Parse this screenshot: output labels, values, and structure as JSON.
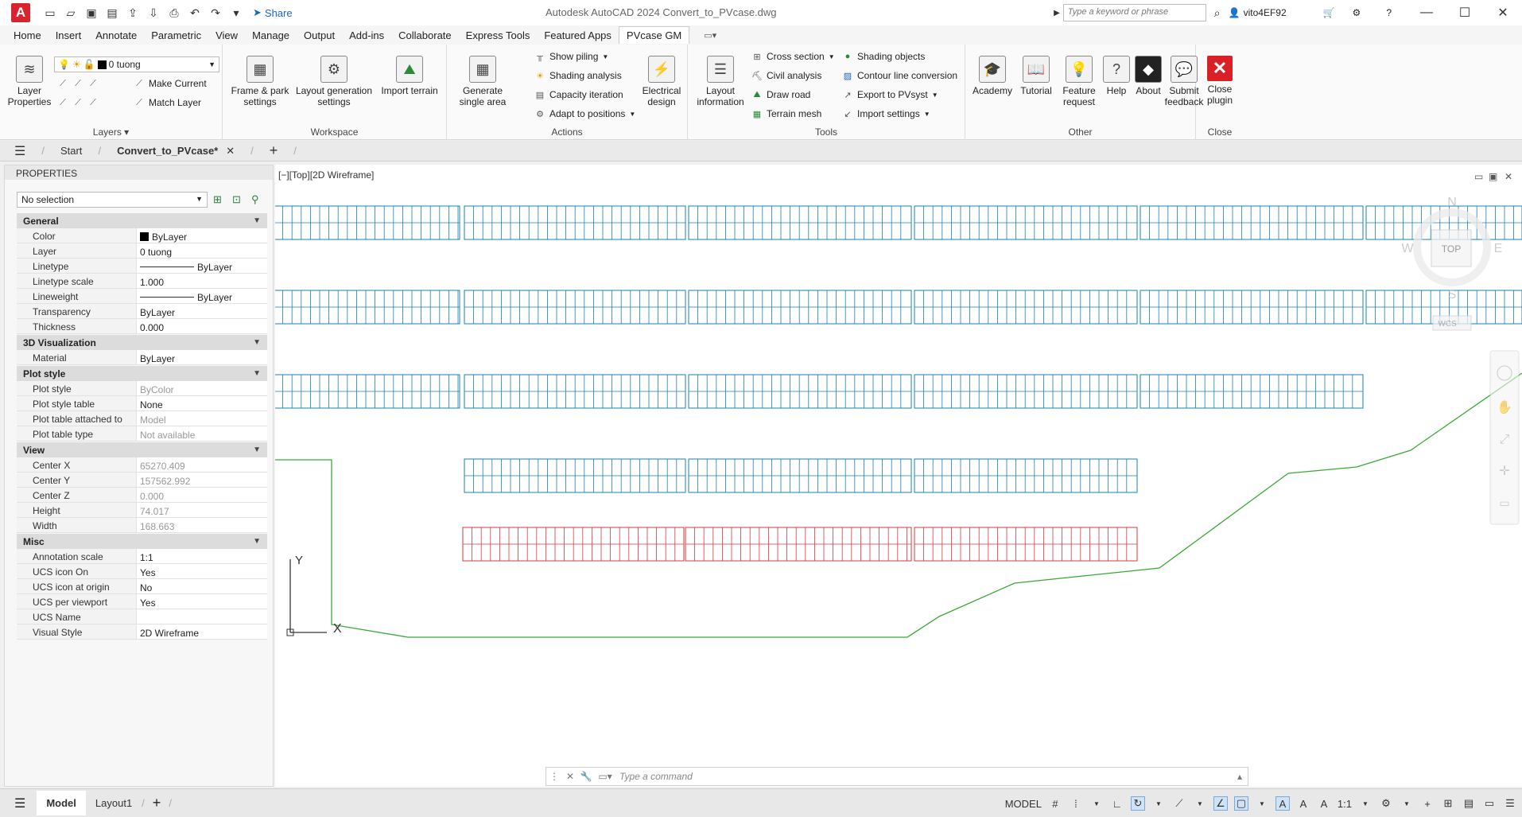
{
  "titlebar": {
    "logo": "A",
    "share": "Share",
    "title": "Autodesk AutoCAD 2024    Convert_to_PVcase.dwg",
    "search_placeholder": "Type a keyword or phrase",
    "user": "vito4EF92"
  },
  "menu": {
    "tabs": [
      "Home",
      "Insert",
      "Annotate",
      "Parametric",
      "View",
      "Manage",
      "Output",
      "Add-ins",
      "Collaborate",
      "Express Tools",
      "Featured Apps",
      "PVcase GM"
    ]
  },
  "ribbon": {
    "layers": {
      "layer_properties": "Layer Properties",
      "current_layer": "0 tuong",
      "make_current": "Make Current",
      "match_layer": "Match Layer",
      "title": "Layers"
    },
    "workspace": {
      "frame_park": "Frame & park settings",
      "layout_generation": "Layout generation settings",
      "import_terrain": "Import terrain",
      "title": "Workspace"
    },
    "actions": {
      "generate_single": "Generate single area",
      "show_piling": "Show piling",
      "shading_analysis": "Shading analysis",
      "capacity_iteration": "Capacity iteration",
      "adapt_positions": "Adapt to positions",
      "electrical_design": "Electrical design",
      "title": "Actions"
    },
    "tools": {
      "layout_information": "Layout information",
      "cross_section": "Cross section",
      "civil_analysis": "Civil analysis",
      "draw_road": "Draw road",
      "terrain_mesh": "Terrain mesh",
      "shading_objects": "Shading objects",
      "contour_conversion": "Contour line conversion",
      "export_pvsyst": "Export to PVsyst",
      "import_settings": "Import settings",
      "title": "Tools"
    },
    "other": {
      "academy": "Academy",
      "tutorial": "Tutorial",
      "feature_request": "Feature request",
      "help": "Help",
      "about": "About",
      "submit_feedback": "Submit feedback",
      "title": "Other"
    },
    "close": {
      "close_plugin": "Close plugin",
      "title": "Close"
    }
  },
  "filetabs": {
    "start": "Start",
    "active": "Convert_to_PVcase*"
  },
  "properties": {
    "header": "PROPERTIES",
    "selection": "No selection",
    "categories": [
      {
        "name": "General",
        "rows": [
          {
            "label": "Color",
            "value": "ByLayer"
          },
          {
            "label": "Layer",
            "value": "0 tuong"
          },
          {
            "label": "Linetype",
            "value": "ByLayer"
          },
          {
            "label": "Linetype scale",
            "value": "1.000"
          },
          {
            "label": "Lineweight",
            "value": "ByLayer"
          },
          {
            "label": "Transparency",
            "value": "ByLayer"
          },
          {
            "label": "Thickness",
            "value": "0.000"
          }
        ]
      },
      {
        "name": "3D Visualization",
        "rows": [
          {
            "label": "Material",
            "value": "ByLayer"
          }
        ]
      },
      {
        "name": "Plot style",
        "rows": [
          {
            "label": "Plot style",
            "value": "ByColor"
          },
          {
            "label": "Plot style table",
            "value": "None"
          },
          {
            "label": "Plot table attached to",
            "value": "Model"
          },
          {
            "label": "Plot table type",
            "value": "Not available"
          }
        ]
      },
      {
        "name": "View",
        "rows": [
          {
            "label": "Center X",
            "value": "65270.409"
          },
          {
            "label": "Center Y",
            "value": "157562.992"
          },
          {
            "label": "Center Z",
            "value": "0.000"
          },
          {
            "label": "Height",
            "value": "74.017"
          },
          {
            "label": "Width",
            "value": "168.663"
          }
        ]
      },
      {
        "name": "Misc",
        "rows": [
          {
            "label": "Annotation scale",
            "value": "1:1"
          },
          {
            "label": "UCS icon On",
            "value": "Yes"
          },
          {
            "label": "UCS icon at origin",
            "value": "No"
          },
          {
            "label": "UCS per viewport",
            "value": "Yes"
          },
          {
            "label": "UCS Name",
            "value": ""
          },
          {
            "label": "Visual Style",
            "value": "2D Wireframe"
          }
        ]
      }
    ]
  },
  "viewport": {
    "label": "[−][Top][2D Wireframe]",
    "viewcube_top": "TOP",
    "compass": {
      "n": "N",
      "s": "S",
      "e": "E",
      "w": "W"
    },
    "wcs": "WCS",
    "ucs_x": "X",
    "ucs_y": "Y",
    "command_placeholder": "Type a command"
  },
  "statusbar": {
    "model_tab": "Model",
    "layout_tab": "Layout1",
    "model_label": "MODEL",
    "scale": "1:1"
  },
  "colors": {
    "panel_blue": "#1a7fb5",
    "panel_red": "#d9383f",
    "boundary_green": "#3aa935",
    "brand_red": "#d9232e"
  }
}
